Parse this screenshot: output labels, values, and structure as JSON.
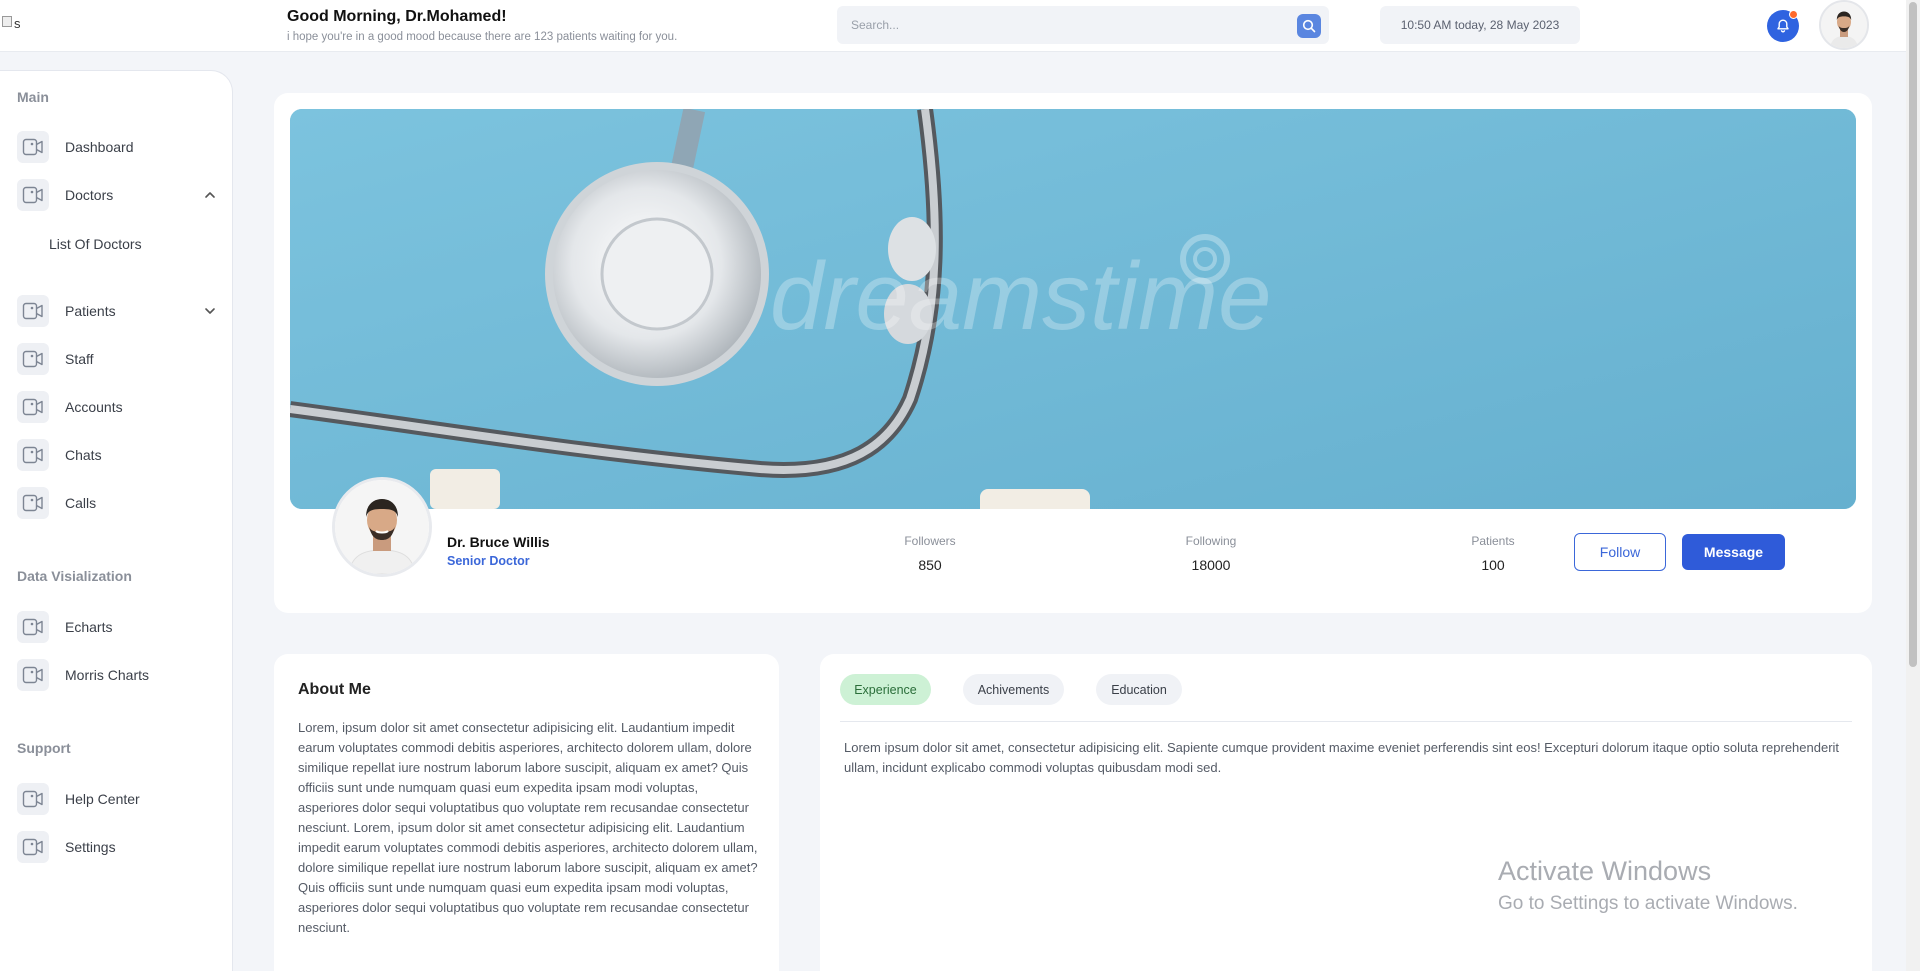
{
  "header": {
    "greeting": "Good Morning, Dr.Mohamed!",
    "subtitle": "i hope you're in a good mood because there are 123 patients waiting for you.",
    "logo_alt": "s",
    "search_placeholder": "Search...",
    "datetime": "10:50 AM today, 28 May 2023",
    "notification_color": "#2f63e0",
    "notification_dot_color": "#ff6a2b"
  },
  "sidebar": {
    "sections": [
      {
        "title": "Main"
      },
      {
        "title": "Data Visialization"
      },
      {
        "title": "Support"
      }
    ],
    "items": {
      "dashboard": "Dashboard",
      "doctors": "Doctors",
      "list_of_doctors": "List Of Doctors",
      "patients": "Patients",
      "staff": "Staff",
      "accounts": "Accounts",
      "chats": "Chats",
      "calls": "Calls",
      "echarts": "Echarts",
      "morris_charts": "Morris Charts",
      "help_center": "Help Center",
      "settings": "Settings"
    }
  },
  "profile": {
    "banner_watermark": "dreamstime",
    "name": "Dr. Bruce Willis",
    "role": "Senior Doctor",
    "stats": [
      {
        "label": "Followers",
        "value": "850"
      },
      {
        "label": "Following",
        "value": "18000"
      },
      {
        "label": "Patients",
        "value": "100"
      }
    ],
    "follow_label": "Follow",
    "message_label": "Message",
    "accent_color": "#2f5bd9"
  },
  "about": {
    "title": "About Me",
    "text": "Lorem, ipsum dolor sit amet consectetur adipisicing elit. Laudantium impedit earum voluptates commodi debitis asperiores, architecto dolorem ullam, dolore similique repellat iure nostrum laborum labore suscipit, aliquam ex amet? Quis officiis sunt unde numquam quasi eum expedita ipsam modi voluptas, asperiores dolor sequi voluptatibus quo voluptate rem recusandae consectetur nesciunt. Lorem, ipsum dolor sit amet consectetur adipisicing elit. Laudantium impedit earum voluptates commodi debitis asperiores, architecto dolorem ullam, dolore similique repellat iure nostrum laborum labore suscipit, aliquam ex amet? Quis officiis sunt unde numquam quasi eum expedita ipsam modi voluptas, asperiores dolor sequi voluptatibus quo voluptate rem recusandae consectetur nesciunt."
  },
  "tabs": {
    "items": [
      {
        "label": "Experience",
        "active": true
      },
      {
        "label": "Achivements",
        "active": false
      },
      {
        "label": "Education",
        "active": false
      }
    ],
    "content": "Lorem ipsum dolor sit amet, consectetur adipisicing elit. Sapiente cumque provident maxime eveniet perferendis sint eos! Excepturi dolorum itaque optio soluta reprehenderit ullam, incidunt explicabo commodi voluptas quibusdam modi sed.",
    "active_color": "#cdf1d5"
  },
  "watermark": {
    "line1": "Activate Windows",
    "line2": "Go to Settings to activate Windows."
  }
}
